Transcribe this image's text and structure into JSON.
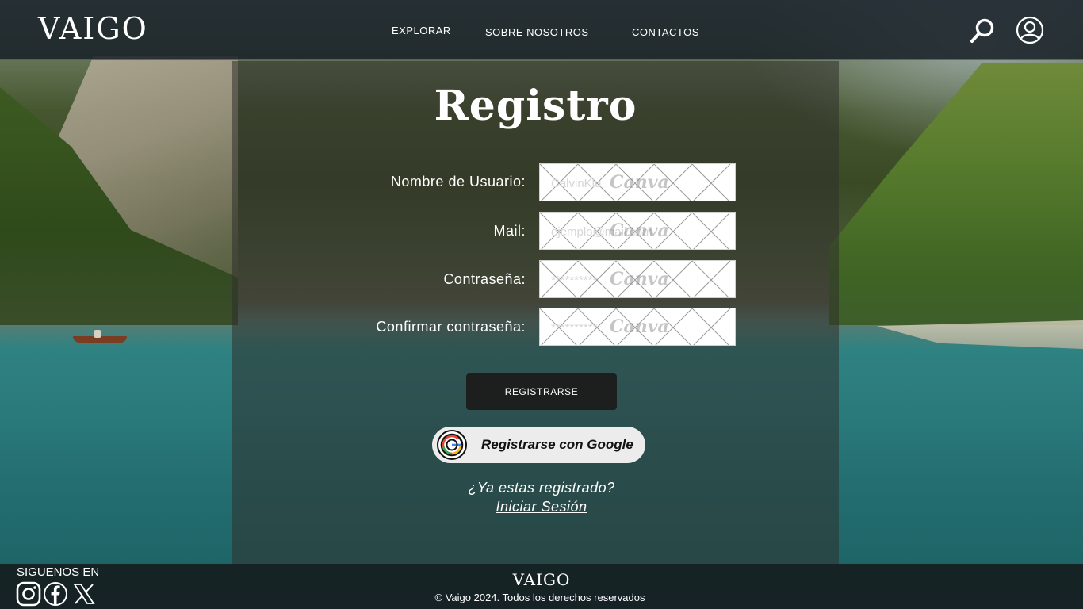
{
  "brand": {
    "logo": "VAIGO"
  },
  "nav": {
    "links": [
      "EXPLORAR",
      "SOBRE NOSOTROS",
      "CONTACTOS"
    ],
    "icons": [
      "search-icon",
      "user-icon"
    ]
  },
  "form": {
    "title": "Registro",
    "fields": [
      {
        "label": "Nombre de Usuario:",
        "placeholder": "CalvinKlu",
        "type": "text"
      },
      {
        "label": "Mail:",
        "placeholder": "ejemplo@mail.com",
        "type": "email"
      },
      {
        "label": "Contraseña:",
        "placeholder": "**********",
        "type": "password"
      },
      {
        "label": "Confirmar contraseña:",
        "placeholder": "**********",
        "type": "password"
      }
    ],
    "watermark": "Canva",
    "register_label": "REGISTRARSE",
    "google_label": "Registrarse con Google",
    "already_text": "¿Ya estas registrado?",
    "login_link": "Iniciar Sesión"
  },
  "footer": {
    "follow_label": "SIGUENOS EN",
    "social_icons": [
      "instagram-icon",
      "facebook-icon",
      "x-icon"
    ],
    "logo": "VAIGO",
    "copyright": "© Vaigo 2024. Todos los derechos reservados"
  },
  "colors": {
    "nav_bg": "#161e26",
    "panel_bg": "#30302c",
    "button_dark": "#1c1f1d",
    "google_bg": "#ececec"
  }
}
